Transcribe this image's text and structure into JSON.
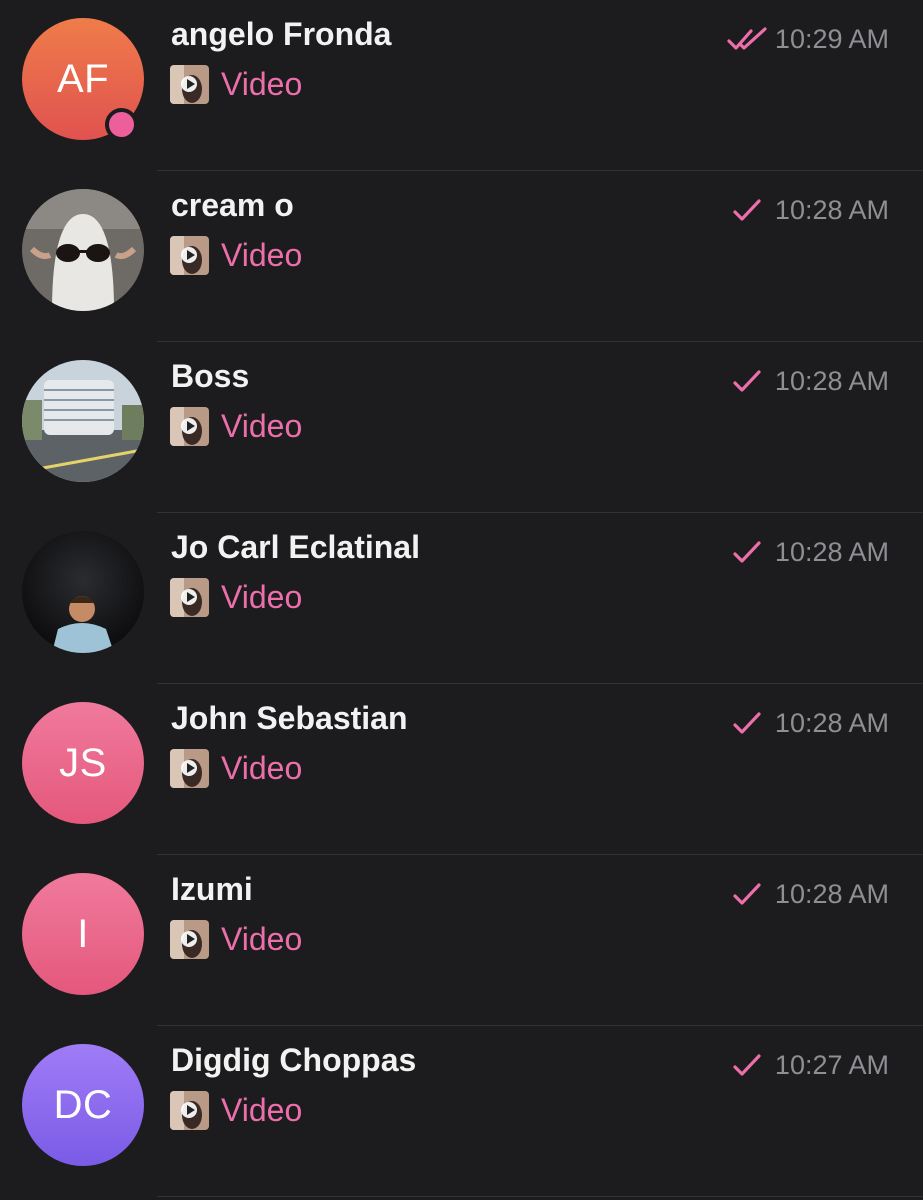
{
  "colors": {
    "background": "#1c1c1e",
    "accent_pink": "#ec6fab",
    "time_gray": "#8e8e93",
    "divider": "#323234"
  },
  "chats": [
    {
      "name": "angelo Fronda",
      "avatar_initials": "AF",
      "avatar_color": "#e86a4e",
      "online": true,
      "preview_icon": "video-thumbnail-icon",
      "preview": "Video",
      "status_icon": "double-check-icon",
      "time": "10:29 AM"
    },
    {
      "name": "cream o",
      "avatar_icon": "ghost-photo-avatar",
      "preview_icon": "video-thumbnail-icon",
      "preview": "Video",
      "status_icon": "single-check-icon",
      "time": "10:28 AM"
    },
    {
      "name": "Boss",
      "avatar_icon": "building-photo-avatar",
      "preview_icon": "video-thumbnail-icon",
      "preview": "Video",
      "status_icon": "single-check-icon",
      "time": "10:28 AM"
    },
    {
      "name": "Jo Carl Eclatinal",
      "avatar_icon": "person-photo-avatar",
      "preview_icon": "video-thumbnail-icon",
      "preview": "Video",
      "status_icon": "single-check-icon",
      "time": "10:28 AM"
    },
    {
      "name": "John Sebastian",
      "avatar_initials": "JS",
      "avatar_color": "#e8638a",
      "preview_icon": "video-thumbnail-icon",
      "preview": "Video",
      "status_icon": "single-check-icon",
      "time": "10:28 AM"
    },
    {
      "name": "Izumi",
      "avatar_initials": "I",
      "avatar_color": "#e8638a",
      "preview_icon": "video-thumbnail-icon",
      "preview": "Video",
      "status_icon": "single-check-icon",
      "time": "10:28 AM"
    },
    {
      "name": "Digdig Choppas",
      "avatar_initials": "DC",
      "avatar_color": "#8a6cf0",
      "preview_icon": "video-thumbnail-icon",
      "preview": "Video",
      "status_icon": "single-check-icon",
      "time": "10:27 AM"
    }
  ]
}
